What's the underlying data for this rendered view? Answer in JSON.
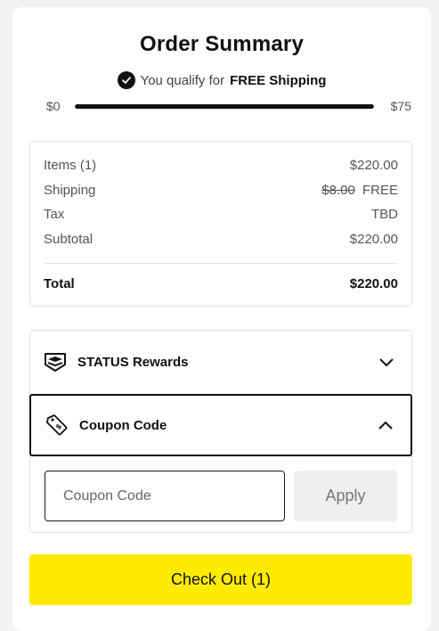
{
  "title": "Order Summary",
  "shipping_banner": {
    "prefix": "You qualify for",
    "highlight": "FREE Shipping",
    "min_label": "$0",
    "max_label": "$75",
    "progress_fraction": 1.0
  },
  "summary": {
    "items_label": "Items (1)",
    "items_value": "$220.00",
    "shipping_label": "Shipping",
    "shipping_original": "$8.00",
    "shipping_value": "FREE",
    "tax_label": "Tax",
    "tax_value": "TBD",
    "subtotal_label": "Subtotal",
    "subtotal_value": "$220.00",
    "total_label": "Total",
    "total_value": "$220.00"
  },
  "rewards": {
    "label": "STATUS Rewards",
    "icon": "status-rewards-icon",
    "expanded": false
  },
  "coupon": {
    "label": "Coupon Code",
    "icon": "coupon-tag-icon",
    "expanded": true,
    "input_value": "",
    "input_placeholder": "Coupon Code",
    "apply_label": "Apply"
  },
  "checkout": {
    "label": "Check Out (1)"
  },
  "colors": {
    "accent_yellow": "#ffeb00",
    "dark": "#111111"
  }
}
